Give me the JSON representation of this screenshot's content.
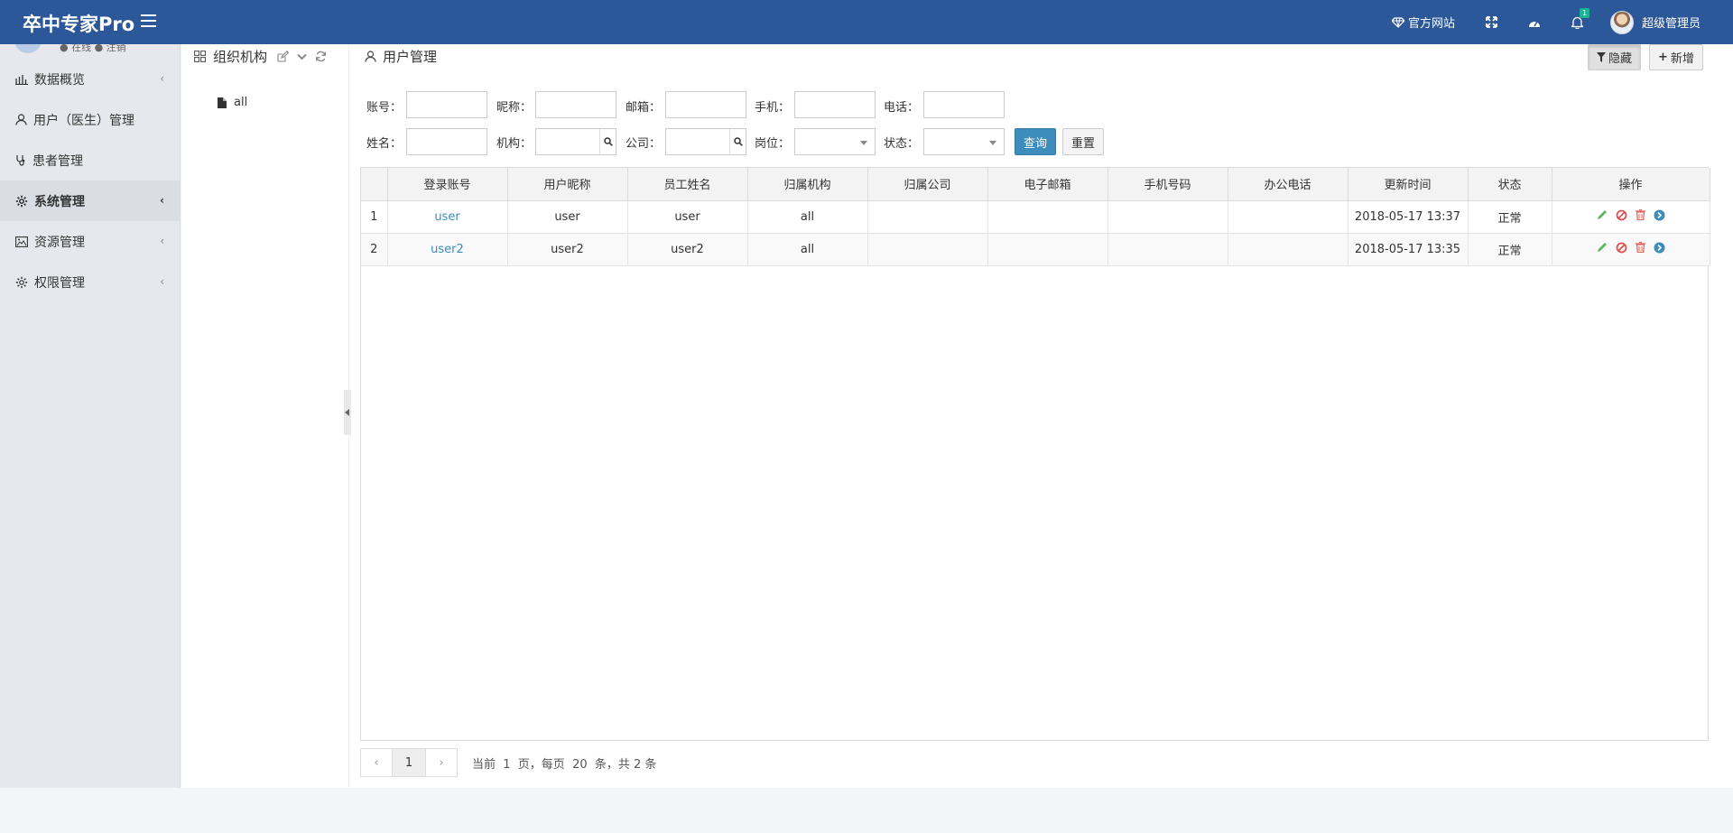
{
  "header": {
    "logo": "卒中专家Pro",
    "links": {
      "site": "官方网站",
      "badge": "1",
      "user": "超级管理员"
    }
  },
  "sidebar": {
    "profile_text": "● 在线 ● 注销",
    "items": [
      {
        "label": "数据概览",
        "icon": "bar-chart-icon"
      },
      {
        "label": "用户（医生）管理",
        "icon": "user-icon"
      },
      {
        "label": "患者管理",
        "icon": "stethoscope-icon"
      },
      {
        "label": "系统管理",
        "icon": "gear-icon"
      },
      {
        "label": "资源管理",
        "icon": "image-icon"
      },
      {
        "label": "权限管理",
        "icon": "gear-icon"
      }
    ]
  },
  "org": {
    "title": "组织机构",
    "tree": [
      "all"
    ]
  },
  "main": {
    "title": "用户管理",
    "btn_hide": "隐藏",
    "btn_add": "新增"
  },
  "filters": {
    "account": "账号：",
    "nickname": "昵称：",
    "email": "邮箱：",
    "mobile": "手机：",
    "phone": "电话：",
    "name": "姓名：",
    "org": "机构：",
    "company": "公司：",
    "post": "岗位：",
    "status": "状态：",
    "query": "查询",
    "reset": "重置"
  },
  "table": {
    "columns": [
      "",
      "登录账号",
      "用户昵称",
      "员工姓名",
      "归属机构",
      "归属公司",
      "电子邮箱",
      "手机号码",
      "办公电话",
      "更新时间",
      "状态",
      "操作"
    ],
    "rows": [
      [
        "1",
        "user",
        "user",
        "user",
        "all",
        "",
        "",
        "",
        "",
        "2018-05-17 13:37",
        "正常"
      ],
      [
        "2",
        "user2",
        "user2",
        "user2",
        "all",
        "",
        "",
        "",
        "",
        "2018-05-17 13:35",
        "正常"
      ]
    ]
  },
  "pager": {
    "prev": "‹",
    "page": "1",
    "next": "›",
    "info": "当前  1  页，每页  20  条，共 2 条"
  },
  "colors": {
    "header": "#2c5899",
    "accent": "#3c8dbc"
  }
}
